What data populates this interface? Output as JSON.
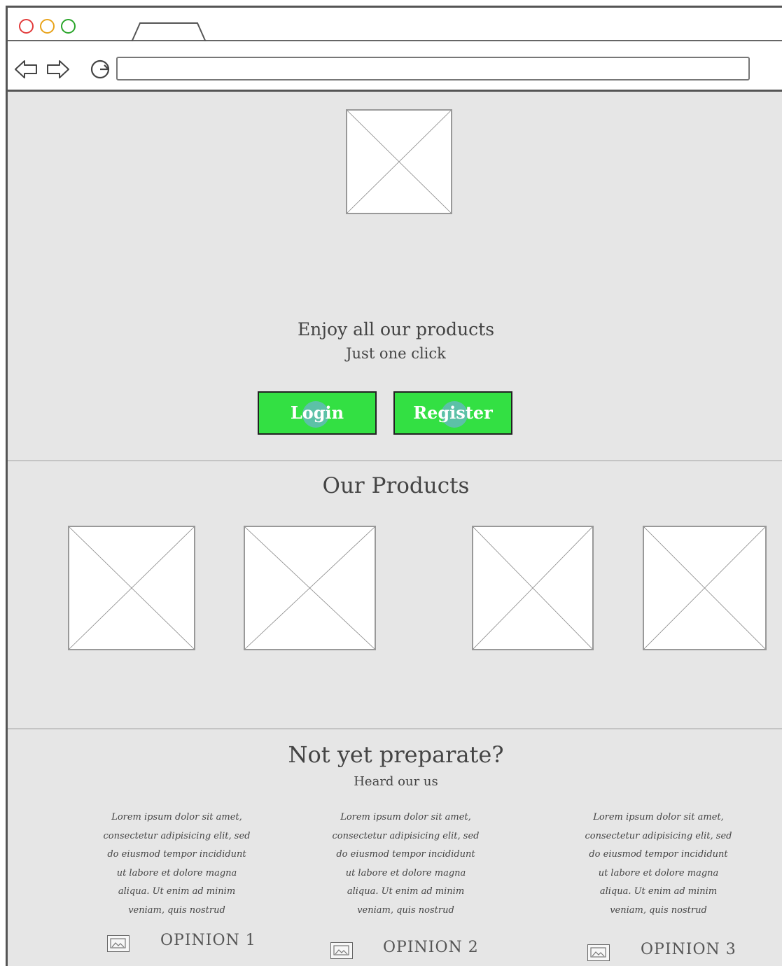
{
  "browser": {
    "window_buttons": [
      {
        "name": "close",
        "color": "#e23b3b"
      },
      {
        "name": "minimize",
        "color": "#e8a31a"
      },
      {
        "name": "maximize",
        "color": "#2aa52a"
      }
    ],
    "address_value": ""
  },
  "hero": {
    "headline": "Enjoy all our products",
    "subline": "Just one click",
    "login_label": "Login",
    "register_label": "Register",
    "button_color": "#33e043"
  },
  "products": {
    "title": "Our Products"
  },
  "opinions": {
    "title": "Not yet preparate?",
    "subtitle": "Heard our us",
    "items": [
      {
        "text": "Lorem ipsum dolor sit amet, consectetur adipisicing elit, sed do eiusmod tempor incididunt ut labore et dolore magna aliqua. Ut enim ad minim veniam, quis nostrud",
        "label": "OPINION 1"
      },
      {
        "text": "Lorem ipsum dolor sit amet, consectetur adipisicing elit, sed do eiusmod tempor incididunt ut labore et dolore magna aliqua. Ut enim ad minim veniam, quis nostrud",
        "label": "OPINION 2"
      },
      {
        "text": "Lorem ipsum dolor sit amet, consectetur adipisicing elit, sed do eiusmod tempor incididunt ut labore et dolore magna aliqua. Ut enim ad minim veniam, quis nostrud",
        "label": "OPINION 3"
      }
    ]
  }
}
